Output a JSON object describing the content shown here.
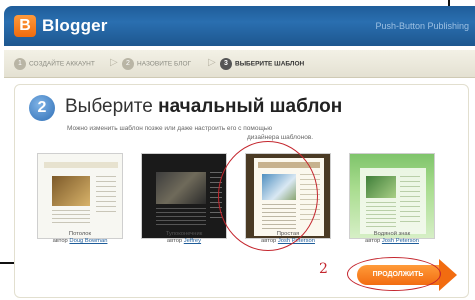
{
  "header": {
    "logo_letter": "B",
    "brand": "Blogger",
    "right_text": "Push-Button Publishing"
  },
  "steps": [
    {
      "num": "1",
      "label": "создайте аккаунт"
    },
    {
      "num": "2",
      "label": "назовите блог"
    },
    {
      "num": "3",
      "label": "выберите шаблон"
    }
  ],
  "main": {
    "step_number": "2",
    "title_prefix": "Выберите ",
    "title_bold": "начальный шаблон",
    "description_1": "Можно изменить шаблон позже или даже настроить его с помощью",
    "description_2": "дизайнера шаблонов."
  },
  "templates": [
    {
      "name": "Потолок",
      "author_label": "автор",
      "author": "Doug Bowman"
    },
    {
      "name": "Тупоконечник",
      "author_label": "автор",
      "author": "Jeffrey"
    },
    {
      "name": "Простая",
      "author_label": "автор",
      "author": "Josh Peterson"
    },
    {
      "name": "Водяной знак",
      "author_label": "автор",
      "author": "Josh Peterson"
    }
  ],
  "annotation_number": "2",
  "continue_button": "Продолжить",
  "colors": {
    "header_blue": "#1f5d9a",
    "accent_orange": "#f26c10",
    "annotation_red": "#c4262e"
  }
}
